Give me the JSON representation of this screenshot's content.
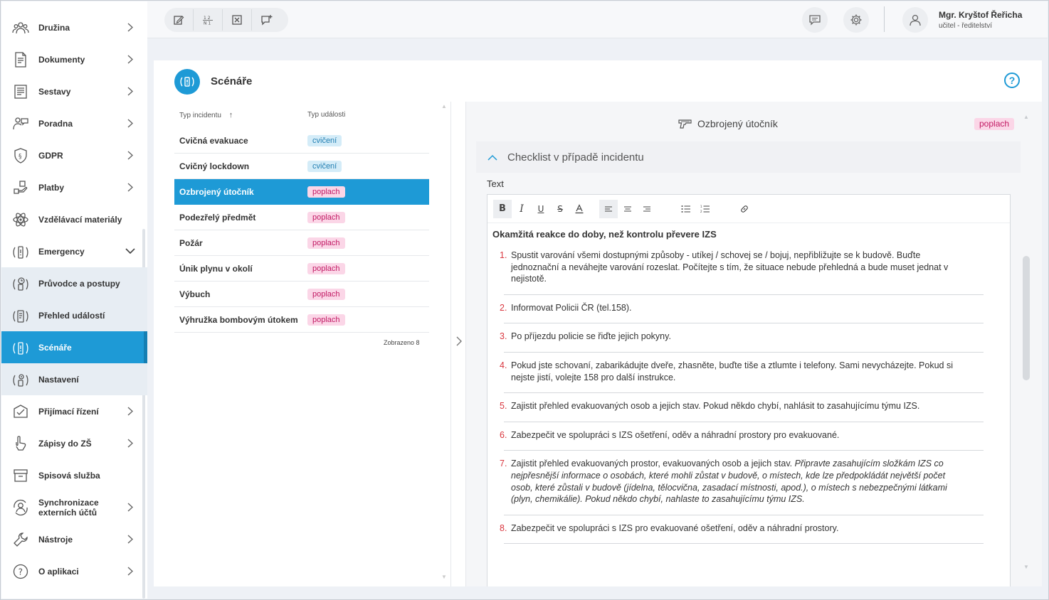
{
  "sidebar": {
    "items": [
      {
        "label": "Družina",
        "icon": "group-icon",
        "chevron": true
      },
      {
        "label": "Dokumenty",
        "icon": "document-icon",
        "chevron": true
      },
      {
        "label": "Sestavy",
        "icon": "report-icon",
        "chevron": true
      },
      {
        "label": "Poradna",
        "icon": "counseling-icon",
        "chevron": true
      },
      {
        "label": "GDPR",
        "icon": "shield-icon",
        "chevron": true
      },
      {
        "label": "Platby",
        "icon": "payment-icon",
        "chevron": true
      },
      {
        "label": "Vzdělávací materiály",
        "icon": "atom-icon",
        "chevron": false
      },
      {
        "label": "Emergency",
        "icon": "emergency-icon",
        "chevron": "down"
      },
      {
        "label": "Průvodce a postupy",
        "icon": "emergency-guide-icon",
        "sub": true
      },
      {
        "label": "Přehled událostí",
        "icon": "emergency-events-icon",
        "sub": true
      },
      {
        "label": "Scénáře",
        "icon": "emergency-scenario-icon",
        "sub": true,
        "active": true
      },
      {
        "label": "Nastavení",
        "icon": "emergency-settings-icon",
        "sub": true
      },
      {
        "label": "Přijímací řízení",
        "icon": "admission-icon",
        "chevron": true
      },
      {
        "label": "Zápisy do ZŠ",
        "icon": "enrollment-icon",
        "chevron": true
      },
      {
        "label": "Spisová služba",
        "icon": "archive-icon",
        "chevron": false
      },
      {
        "label": "Synchronizace externích účtů",
        "icon": "sync-icon",
        "chevron": true
      },
      {
        "label": "Nástroje",
        "icon": "wrench-icon",
        "chevron": true
      },
      {
        "label": "O aplikaci",
        "icon": "help-circle-icon",
        "chevron": true
      }
    ]
  },
  "topbar": {
    "user_name": "Mgr. Kryštof Řeřicha",
    "user_role": "učitel - ředitelství"
  },
  "page": {
    "title": "Scénáře"
  },
  "list": {
    "col_type": "Typ incidentu",
    "col_event": "Typ události",
    "rows": [
      {
        "name": "Cvičná evakuace",
        "badge": "cvičení",
        "kind": "cv"
      },
      {
        "name": "Cvičný lockdown",
        "badge": "cvičení",
        "kind": "cv"
      },
      {
        "name": "Ozbrojený útočník",
        "badge": "poplach",
        "kind": "po",
        "selected": true
      },
      {
        "name": "Podezřelý předmět",
        "badge": "poplach",
        "kind": "po"
      },
      {
        "name": "Požár",
        "badge": "poplach",
        "kind": "po"
      },
      {
        "name": "Únik plynu v okolí",
        "badge": "poplach",
        "kind": "po"
      },
      {
        "name": "Výbuch",
        "badge": "poplach",
        "kind": "po"
      },
      {
        "name": "Výhružka bombovým útokem",
        "badge": "poplach",
        "kind": "po"
      }
    ],
    "count": "Zobrazeno 8"
  },
  "detail": {
    "title": "Ozbrojený útočník",
    "badge": "poplach",
    "section": "Checklist v případě incidentu",
    "text_label": "Text",
    "heading": "Okamžitá reakce do doby, než kontrolu převere IZS",
    "items": [
      {
        "num": "1.",
        "text": "Spustit varování všemi dostupnými způsoby - utíkej / schovej se / bojuj, nepřibližujte se k budově. Buďte jednoznační a neváhejte varování rozeslat. Počítejte s tím, že situace nebude přehledná a bude muset jednat v nejistotě.",
        "italic": ""
      },
      {
        "num": "2.",
        "text": "Informovat Policii ČR (tel.158).",
        "italic": ""
      },
      {
        "num": "3.",
        "text": "Po příjezdu policie se řiďte jejich pokyny.",
        "italic": ""
      },
      {
        "num": "4.",
        "text": "Pokud jste schovaní, zabarikádujte dveře, zhasněte, buďte tiše a ztlumte i telefony. Sami nevycházejte. Pokud si nejste jistí, volejte 158 pro další instrukce.",
        "italic": ""
      },
      {
        "num": "5.",
        "text": "Zajistit přehled evakuovaných osob a jejich stav. Pokud někdo chybí, nahlásit to zasahujícímu týmu IZS.",
        "italic": ""
      },
      {
        "num": "6.",
        "text": "Zabezpečit ve spolupráci s IZS ošetření, oděv a náhradní prostory pro evakuované.",
        "italic": ""
      },
      {
        "num": "7.",
        "text": "Zajistit přehled evakuovaných prostor, evakuovaných osob a jejich stav. ",
        "italic": "Připravte zasahujícím složkám IZS co nejpřesnější informace o osobách, které mohli zůstat v budově, o místech, kde lze předpokládát největší počet osob, které zůstali v budově (jídelna, tělocvična, zasadací místnosti, apod.), o místech s nebezpečnými látkami (plyn, chemikálie). Pokud někdo chybí, nahlaste to zasahujícímu týmu IZS."
      },
      {
        "num": "8.",
        "text": "Zabezpečit ve spolupráci s IZS pro evakuované ošetření, oděv a náhradní prostory.",
        "italic": ""
      }
    ]
  },
  "colors": {
    "accent": "#1e9ad6",
    "badge_cviceni_bg": "#d4ecf8",
    "badge_poplach_bg": "#fbd6e7",
    "badge_poplach_text": "#c21a64"
  }
}
